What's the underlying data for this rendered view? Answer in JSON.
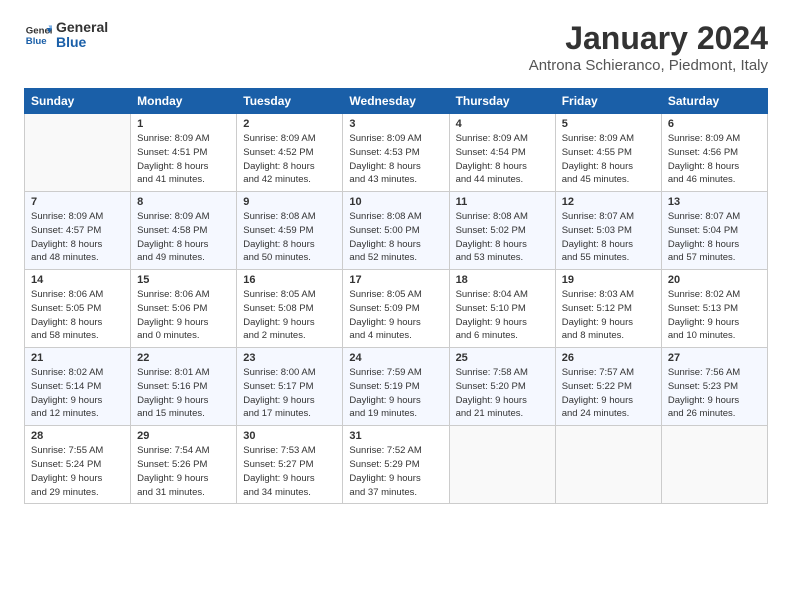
{
  "logo": {
    "line1": "General",
    "line2": "Blue"
  },
  "title": "January 2024",
  "location": "Antrona Schieranco, Piedmont, Italy",
  "weekdays": [
    "Sunday",
    "Monday",
    "Tuesday",
    "Wednesday",
    "Thursday",
    "Friday",
    "Saturday"
  ],
  "weeks": [
    [
      {
        "day": "",
        "info": ""
      },
      {
        "day": "1",
        "info": "Sunrise: 8:09 AM\nSunset: 4:51 PM\nDaylight: 8 hours\nand 41 minutes."
      },
      {
        "day": "2",
        "info": "Sunrise: 8:09 AM\nSunset: 4:52 PM\nDaylight: 8 hours\nand 42 minutes."
      },
      {
        "day": "3",
        "info": "Sunrise: 8:09 AM\nSunset: 4:53 PM\nDaylight: 8 hours\nand 43 minutes."
      },
      {
        "day": "4",
        "info": "Sunrise: 8:09 AM\nSunset: 4:54 PM\nDaylight: 8 hours\nand 44 minutes."
      },
      {
        "day": "5",
        "info": "Sunrise: 8:09 AM\nSunset: 4:55 PM\nDaylight: 8 hours\nand 45 minutes."
      },
      {
        "day": "6",
        "info": "Sunrise: 8:09 AM\nSunset: 4:56 PM\nDaylight: 8 hours\nand 46 minutes."
      }
    ],
    [
      {
        "day": "7",
        "info": "Sunrise: 8:09 AM\nSunset: 4:57 PM\nDaylight: 8 hours\nand 48 minutes."
      },
      {
        "day": "8",
        "info": "Sunrise: 8:09 AM\nSunset: 4:58 PM\nDaylight: 8 hours\nand 49 minutes."
      },
      {
        "day": "9",
        "info": "Sunrise: 8:08 AM\nSunset: 4:59 PM\nDaylight: 8 hours\nand 50 minutes."
      },
      {
        "day": "10",
        "info": "Sunrise: 8:08 AM\nSunset: 5:00 PM\nDaylight: 8 hours\nand 52 minutes."
      },
      {
        "day": "11",
        "info": "Sunrise: 8:08 AM\nSunset: 5:02 PM\nDaylight: 8 hours\nand 53 minutes."
      },
      {
        "day": "12",
        "info": "Sunrise: 8:07 AM\nSunset: 5:03 PM\nDaylight: 8 hours\nand 55 minutes."
      },
      {
        "day": "13",
        "info": "Sunrise: 8:07 AM\nSunset: 5:04 PM\nDaylight: 8 hours\nand 57 minutes."
      }
    ],
    [
      {
        "day": "14",
        "info": "Sunrise: 8:06 AM\nSunset: 5:05 PM\nDaylight: 8 hours\nand 58 minutes."
      },
      {
        "day": "15",
        "info": "Sunrise: 8:06 AM\nSunset: 5:06 PM\nDaylight: 9 hours\nand 0 minutes."
      },
      {
        "day": "16",
        "info": "Sunrise: 8:05 AM\nSunset: 5:08 PM\nDaylight: 9 hours\nand 2 minutes."
      },
      {
        "day": "17",
        "info": "Sunrise: 8:05 AM\nSunset: 5:09 PM\nDaylight: 9 hours\nand 4 minutes."
      },
      {
        "day": "18",
        "info": "Sunrise: 8:04 AM\nSunset: 5:10 PM\nDaylight: 9 hours\nand 6 minutes."
      },
      {
        "day": "19",
        "info": "Sunrise: 8:03 AM\nSunset: 5:12 PM\nDaylight: 9 hours\nand 8 minutes."
      },
      {
        "day": "20",
        "info": "Sunrise: 8:02 AM\nSunset: 5:13 PM\nDaylight: 9 hours\nand 10 minutes."
      }
    ],
    [
      {
        "day": "21",
        "info": "Sunrise: 8:02 AM\nSunset: 5:14 PM\nDaylight: 9 hours\nand 12 minutes."
      },
      {
        "day": "22",
        "info": "Sunrise: 8:01 AM\nSunset: 5:16 PM\nDaylight: 9 hours\nand 15 minutes."
      },
      {
        "day": "23",
        "info": "Sunrise: 8:00 AM\nSunset: 5:17 PM\nDaylight: 9 hours\nand 17 minutes."
      },
      {
        "day": "24",
        "info": "Sunrise: 7:59 AM\nSunset: 5:19 PM\nDaylight: 9 hours\nand 19 minutes."
      },
      {
        "day": "25",
        "info": "Sunrise: 7:58 AM\nSunset: 5:20 PM\nDaylight: 9 hours\nand 21 minutes."
      },
      {
        "day": "26",
        "info": "Sunrise: 7:57 AM\nSunset: 5:22 PM\nDaylight: 9 hours\nand 24 minutes."
      },
      {
        "day": "27",
        "info": "Sunrise: 7:56 AM\nSunset: 5:23 PM\nDaylight: 9 hours\nand 26 minutes."
      }
    ],
    [
      {
        "day": "28",
        "info": "Sunrise: 7:55 AM\nSunset: 5:24 PM\nDaylight: 9 hours\nand 29 minutes."
      },
      {
        "day": "29",
        "info": "Sunrise: 7:54 AM\nSunset: 5:26 PM\nDaylight: 9 hours\nand 31 minutes."
      },
      {
        "day": "30",
        "info": "Sunrise: 7:53 AM\nSunset: 5:27 PM\nDaylight: 9 hours\nand 34 minutes."
      },
      {
        "day": "31",
        "info": "Sunrise: 7:52 AM\nSunset: 5:29 PM\nDaylight: 9 hours\nand 37 minutes."
      },
      {
        "day": "",
        "info": ""
      },
      {
        "day": "",
        "info": ""
      },
      {
        "day": "",
        "info": ""
      }
    ]
  ]
}
